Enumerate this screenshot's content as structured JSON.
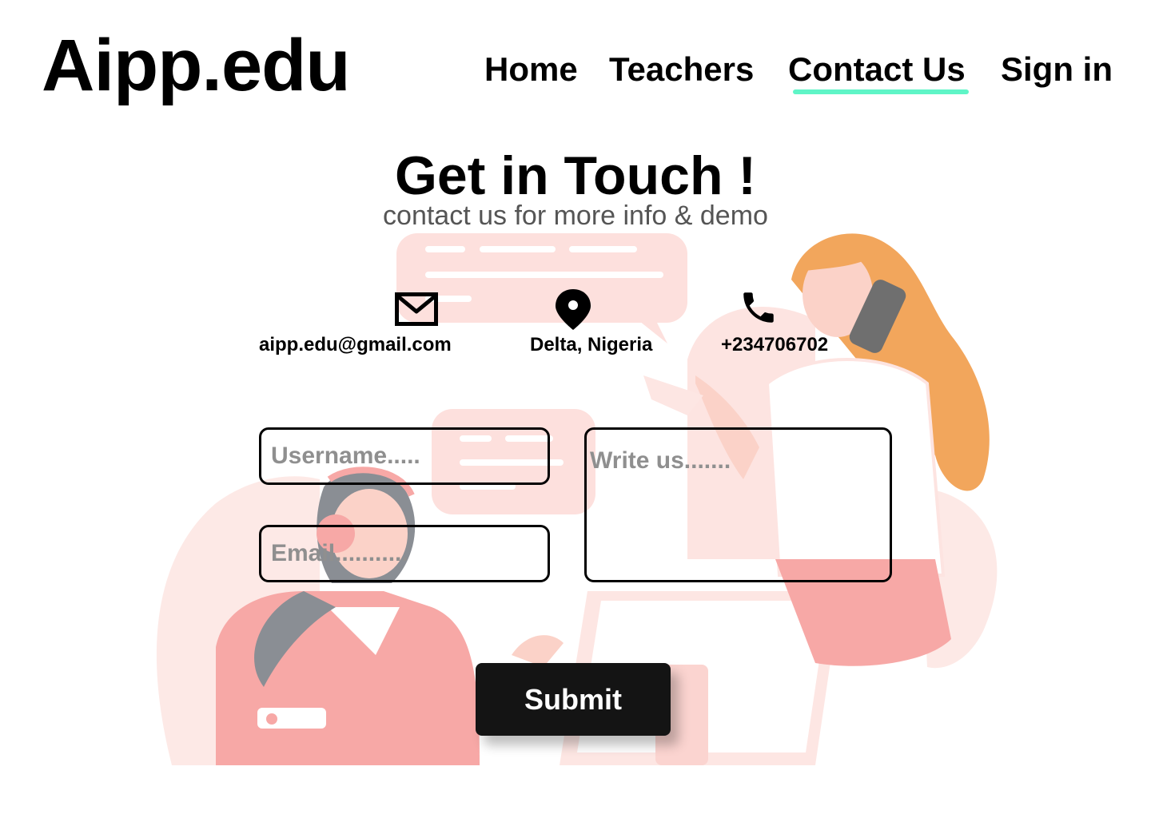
{
  "brand": {
    "logo": "Aipp.edu"
  },
  "nav": {
    "items": [
      {
        "label": "Home"
      },
      {
        "label": "Teachers"
      },
      {
        "label": "Contact Us",
        "active": true
      },
      {
        "label": "Sign in"
      }
    ]
  },
  "hero": {
    "title": "Get in Touch !",
    "subtitle": "contact us for more info & demo"
  },
  "contact": {
    "email": "aipp.edu@gmail.com",
    "location": "Delta, Nigeria",
    "phone": "+234706702"
  },
  "form": {
    "username_placeholder": "Username.....",
    "email_placeholder": "Email...........",
    "message_placeholder": "Write us.......",
    "submit_label": "Submit"
  },
  "icons": {
    "email": "mail-icon",
    "location": "location-pin-icon",
    "phone": "phone-icon"
  },
  "colors": {
    "accent": "#5ff5c7",
    "button": "#141414",
    "illustration_pink": "#fbb4b4",
    "illustration_orange": "#f2a65c"
  }
}
